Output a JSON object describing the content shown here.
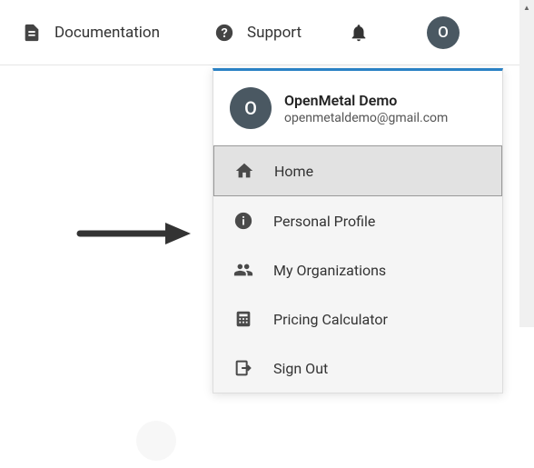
{
  "topbar": {
    "documentation_label": "Documentation",
    "support_label": "Support",
    "avatar_initial": "O"
  },
  "user": {
    "avatar_initial": "O",
    "name": "OpenMetal Demo",
    "email": "openmetaldemo@gmail.com"
  },
  "menu": {
    "home": "Home",
    "profile": "Personal Profile",
    "orgs": "My Organizations",
    "pricing": "Pricing Calculator",
    "signout": "Sign Out"
  },
  "colors": {
    "accent": "#2a81c4",
    "avatar_bg": "#4a5862"
  }
}
